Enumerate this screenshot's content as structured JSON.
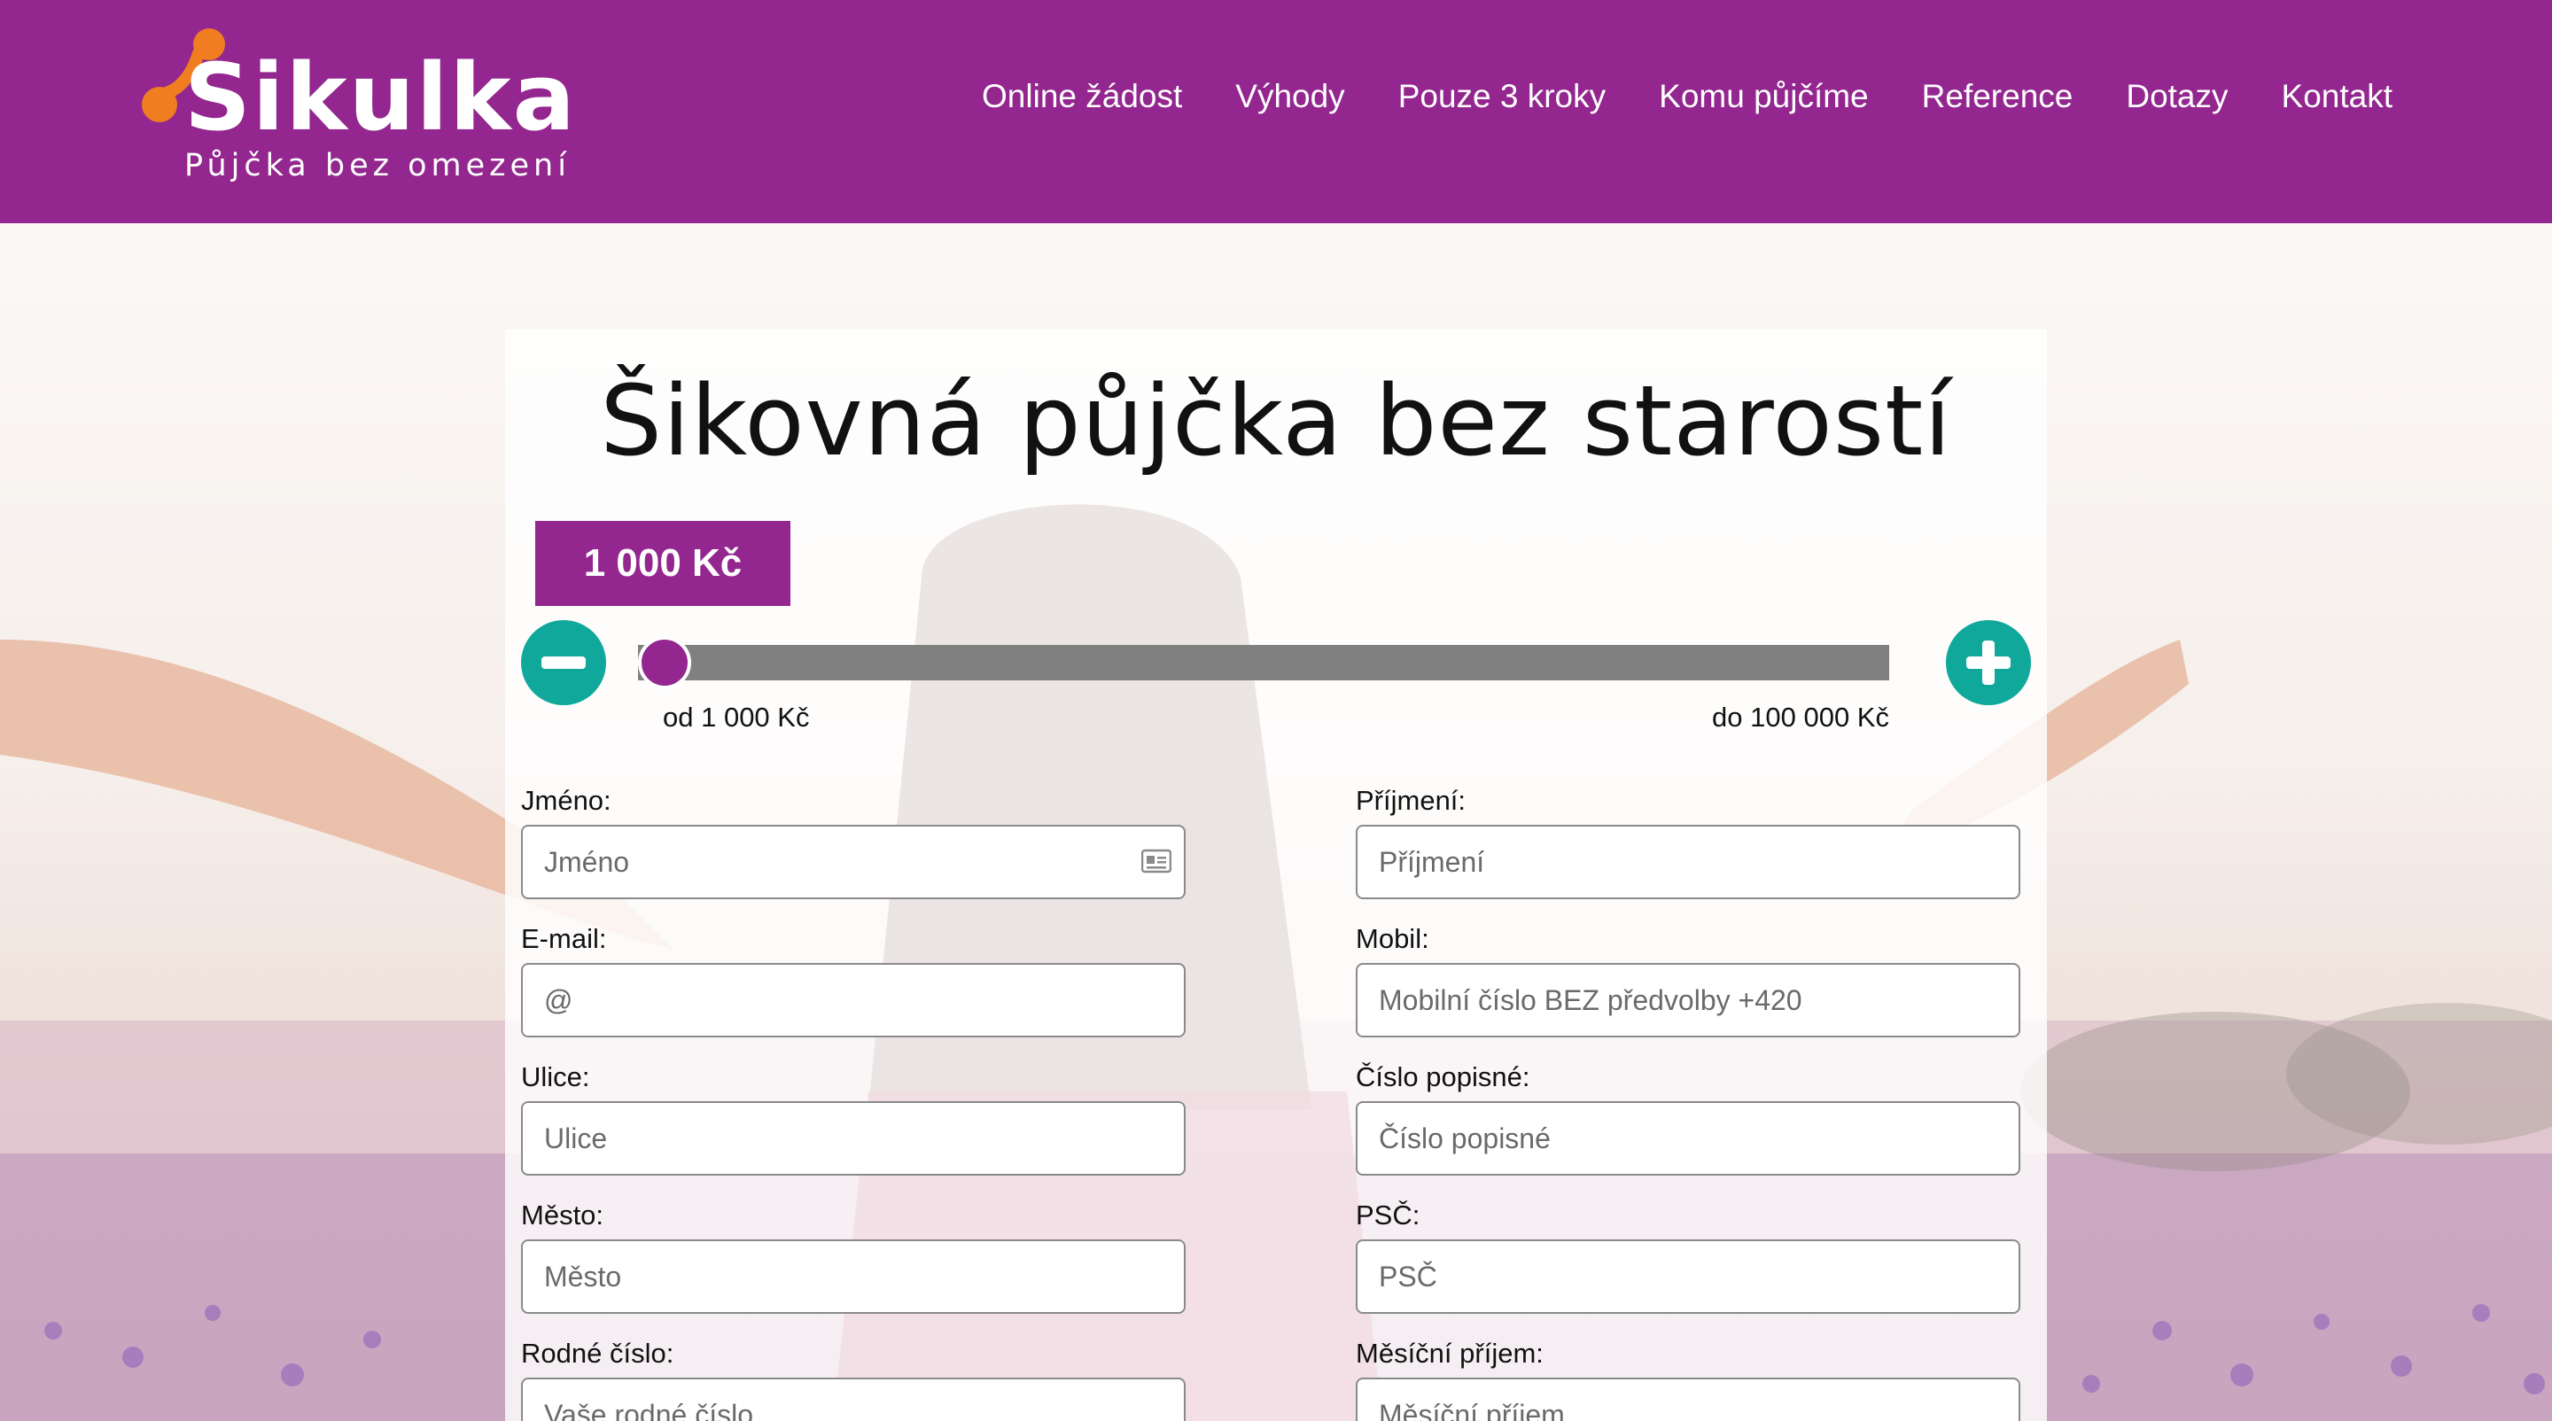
{
  "brand": {
    "name": "Sikulka",
    "tagline": "Půjčka bez omezení",
    "colors": {
      "primary": "#93278f",
      "accent": "#f07d20",
      "teal": "#0fa89b"
    }
  },
  "nav": {
    "items": [
      {
        "label": "Online žádost"
      },
      {
        "label": "Výhody"
      },
      {
        "label": "Pouze 3 kroky"
      },
      {
        "label": "Komu půjčíme"
      },
      {
        "label": "Reference"
      },
      {
        "label": "Dotazy"
      },
      {
        "label": "Kontakt"
      }
    ]
  },
  "form": {
    "title": "Šikovná půjčka bez starostí",
    "amount_display": "1 000 Kč",
    "slider": {
      "min_label": "od 1 000 Kč",
      "max_label": "do 100 000 Kč",
      "value_fraction": 0.0
    },
    "fields": {
      "first_name": {
        "label": "Jméno:",
        "placeholder": "Jméno"
      },
      "last_name": {
        "label": "Příjmení:",
        "placeholder": "Příjmení"
      },
      "email": {
        "label": "E-mail:",
        "placeholder": "@"
      },
      "mobile": {
        "label": "Mobil:",
        "placeholder": "Mobilní číslo BEZ předvolby +420"
      },
      "street": {
        "label": "Ulice:",
        "placeholder": "Ulice"
      },
      "house_number": {
        "label": "Číslo popisné:",
        "placeholder": "Číslo popisné"
      },
      "city": {
        "label": "Město:",
        "placeholder": "Město"
      },
      "zip": {
        "label": "PSČ:",
        "placeholder": "PSČ"
      },
      "birth_number": {
        "label": "Rodné číslo:",
        "placeholder": "Vaše rodné číslo"
      },
      "income": {
        "label": "Měsíční příjem:",
        "placeholder": "Měsíční příjem"
      }
    }
  },
  "icons": {
    "minus": "minus-circle-icon",
    "plus": "plus-circle-icon",
    "id_card": "id-card-icon"
  }
}
